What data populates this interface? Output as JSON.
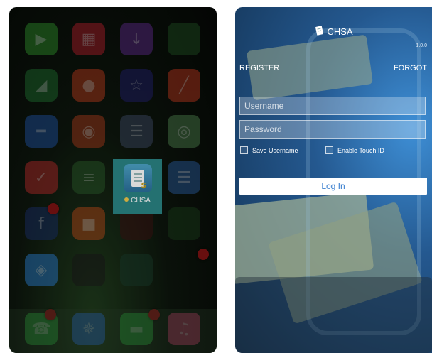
{
  "home_screen": {
    "apps": [
      {
        "color": "#2e8a2a",
        "icon": "video-camera"
      },
      {
        "color": "#a91e2a",
        "icon": "grid"
      },
      {
        "color": "#5b2a86",
        "icon": "download-arrow"
      },
      {
        "color": "#1e4a20",
        "icon": "blank"
      },
      {
        "color": "#1f6b2f",
        "icon": "chart-shape"
      },
      {
        "color": "#b33a1c",
        "icon": "chat-bubble"
      },
      {
        "color": "#22206a",
        "icon": "star"
      },
      {
        "color": "#b3361c",
        "icon": "diagonal-stroke"
      },
      {
        "color": "#1f4f9c",
        "icon": "dash"
      },
      {
        "color": "#a33a1c",
        "icon": "camera-shape"
      },
      {
        "color": "#3d4a63",
        "icon": "cards"
      },
      {
        "color": "#4a7a4a",
        "icon": "maps"
      },
      {
        "color": "#b02a2a",
        "icon": "check-shape"
      },
      {
        "color": "#2a5a2a",
        "icon": "equalizer"
      },
      {
        "color": "#2a5a9a",
        "icon": "notes"
      },
      {
        "color": "#1a2f66",
        "icon": "facebook-f"
      },
      {
        "color": "#b3491a",
        "icon": "food"
      },
      {
        "color": "#3a1212",
        "icon": "blank"
      },
      {
        "color": "#1a3a1a",
        "icon": "blank"
      },
      {
        "color": "#2a7ac9",
        "icon": "messenger"
      },
      {
        "color": "#1a1a1a",
        "icon": "blank"
      },
      {
        "color": "#1a3a2a",
        "icon": "blank"
      },
      {
        "color": "#2aa83a",
        "icon": "phone"
      },
      {
        "color": "#2a6ad0",
        "icon": "safari-compass"
      },
      {
        "color": "#2aa83a",
        "icon": "messages"
      },
      {
        "color": "#c73a6a",
        "icon": "music-note"
      }
    ],
    "highlighted_app": {
      "label": "CHSA",
      "accent": "#2b8585"
    }
  },
  "login_screen": {
    "app_name": "CHSA",
    "version": "1.0.0",
    "register_label": "REGISTER",
    "forgot_label": "FORGOT",
    "username": {
      "value": "",
      "placeholder": "Username"
    },
    "password": {
      "value": "",
      "placeholder": "Password"
    },
    "save_username_label": "Save Username",
    "save_username_checked": false,
    "touch_id_label": "Enable Touch ID",
    "touch_id_checked": false,
    "login_button_label": "Log In",
    "accent_color": "#3a7fcf"
  }
}
